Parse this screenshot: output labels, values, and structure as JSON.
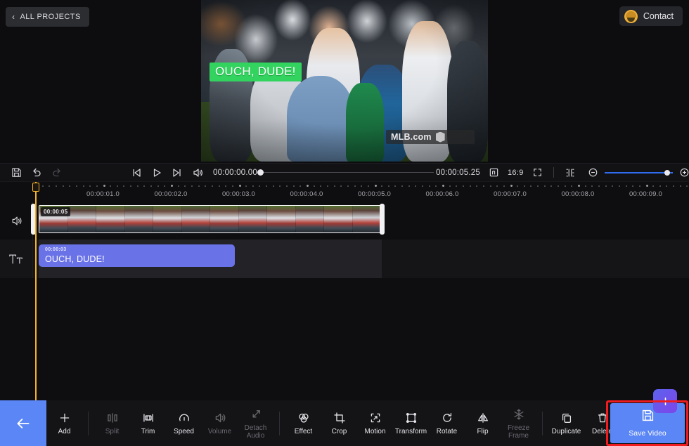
{
  "topbar": {
    "all_projects_label": "ALL PROJECTS",
    "back_chevron_icon": "chevron-left-icon",
    "contact_label": "Contact",
    "avatar_icon": "user-avatar-icon"
  },
  "preview": {
    "caption_text": "OUCH, DUDE!",
    "caption_bg_color": "#32d35f",
    "caption_text_color": "#ffffff",
    "watermark_text": "MLB.com",
    "watermark_icon": "mlb-logo-icon"
  },
  "controls": {
    "save_icon": "floppy-save-icon",
    "undo_icon": "undo-arrow-icon",
    "redo_icon": "redo-arrow-icon",
    "prev_frame_icon": "skip-previous-icon",
    "play_icon": "play-triangle-icon",
    "next_frame_icon": "skip-next-icon",
    "mute_icon": "speaker-volume-icon",
    "current_time": "00:00:00.00",
    "total_time": "00:00:05.25",
    "scrub_position_pct": 0,
    "layout_icon": "layout-grid-icon",
    "aspect_ratio": "16:9",
    "fullscreen_icon": "expand-fullscreen-icon",
    "snap_icon": "snap-magnet-icon",
    "zoom_out_icon": "zoom-minus-icon",
    "zoom_in_icon": "zoom-plus-icon",
    "zoom_level_pct": 92,
    "zoom_accent_color": "#2f6df0"
  },
  "timeline": {
    "ruler_labels": [
      "00:00:01.0",
      "00:00:02.0",
      "00:00:03.0",
      "00:00:04.0",
      "00:00:05.0",
      "00:00:06.0",
      "00:00:07.0",
      "00:00:08.0",
      "00:00:09.0"
    ],
    "playhead_time": "00:00:00.00",
    "video_track": {
      "header_icon": "speaker-volume-icon",
      "clip_badge": "00:00:05",
      "selected": true
    },
    "text_track": {
      "header_icon": "text-tool-icon",
      "clip_time": "00:00:03",
      "clip_label": "OUCH, DUDE!",
      "clip_color": "#6a72e8"
    },
    "add_track_icon": "plus-icon"
  },
  "bottombar": {
    "back_icon": "arrow-left-icon",
    "tools": [
      {
        "label": "Add",
        "icon": "plus-icon",
        "disabled": false
      },
      {
        "label": "Split",
        "icon": "split-clip-icon",
        "disabled": true
      },
      {
        "label": "Trim",
        "icon": "trim-icon",
        "disabled": false
      },
      {
        "label": "Speed",
        "icon": "speedometer-icon",
        "disabled": false
      },
      {
        "label": "Volume",
        "icon": "speaker-volume-icon",
        "disabled": true
      },
      {
        "label": "Detach Audio",
        "icon": "detach-audio-icon",
        "disabled": true
      },
      {
        "label": "Effect",
        "icon": "effect-circles-icon",
        "disabled": false
      },
      {
        "label": "Crop",
        "icon": "crop-icon",
        "disabled": false
      },
      {
        "label": "Motion",
        "icon": "motion-keyframe-icon",
        "disabled": false
      },
      {
        "label": "Transform",
        "icon": "transform-square-icon",
        "disabled": false
      },
      {
        "label": "Rotate",
        "icon": "rotate-cw-icon",
        "disabled": false
      },
      {
        "label": "Flip",
        "icon": "flip-icon",
        "disabled": false
      },
      {
        "label": "Freeze Frame",
        "icon": "snowflake-icon",
        "disabled": true
      },
      {
        "label": "Duplicate",
        "icon": "duplicate-copy-icon",
        "disabled": false
      },
      {
        "label": "Delete",
        "icon": "trash-icon",
        "disabled": false
      }
    ],
    "save_video_label": "Save Video",
    "save_video_icon": "floppy-save-icon",
    "save_button_color": "#5b86f5",
    "highlight_color": "#ef1d20"
  }
}
